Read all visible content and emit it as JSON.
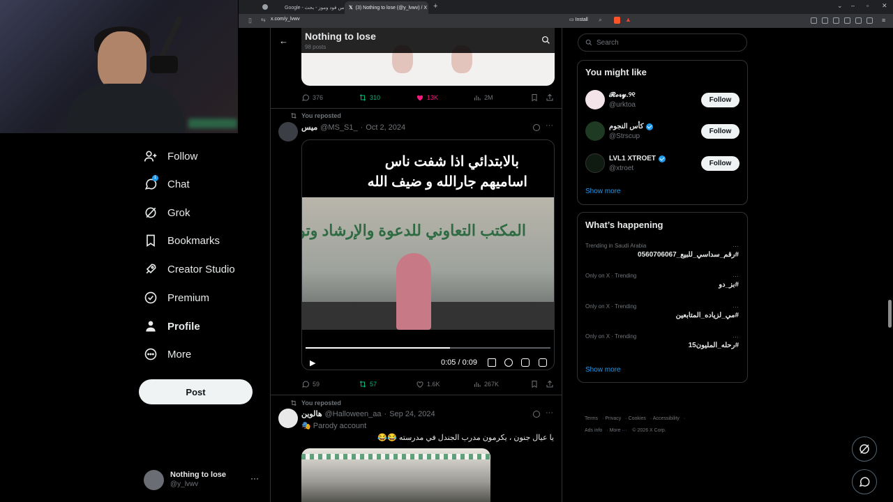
{
  "browser": {
    "tabs": [
      {
        "label": "Google - ريلاكس فود وموز - بحث",
        "active": false
      },
      {
        "label": "(3) Nothing to lose (@y_lvwv) / X",
        "active": true
      }
    ],
    "url": "x.com/y_lvwv",
    "install_label": "Install"
  },
  "nav": {
    "items": [
      {
        "label": "Follow",
        "icon": "person-add-icon"
      },
      {
        "label": "Chat",
        "icon": "chat-icon",
        "badge": "1"
      },
      {
        "label": "Grok",
        "icon": "grok-icon"
      },
      {
        "label": "Bookmarks",
        "icon": "bookmark-icon"
      },
      {
        "label": "Creator Studio",
        "icon": "rocket-icon"
      },
      {
        "label": "Premium",
        "icon": "verified-badge-icon"
      },
      {
        "label": "Profile",
        "icon": "person-icon"
      },
      {
        "label": "More",
        "icon": "more-circle-icon"
      }
    ],
    "post_label": "Post",
    "account": {
      "name": "Nothing to lose",
      "handle": "@y_lvwv"
    }
  },
  "profile_header": {
    "title": "Nothing to lose",
    "subtitle": "98 posts"
  },
  "tweet1": {
    "replies": "376",
    "reposts": "310",
    "likes": "13K",
    "views": "2M"
  },
  "tweet2": {
    "repost_label": "You reposted",
    "name": "ميس",
    "handle": "@MS_S1_",
    "date": "Oct 2, 2024",
    "caption_line1": "بالابتدائي اذا شفت ناس",
    "caption_line2": "اساميهم جارالله و ضيف الله",
    "banner_text": "المكتب التعاوني للدعوة والإرشاد وتوعية الجاليات",
    "video_time": "0:05 / 0:09",
    "video_progress": 0.59,
    "replies": "59",
    "reposts": "57",
    "likes": "1.6K",
    "views": "267K"
  },
  "tweet3": {
    "repost_label": "You reposted",
    "name": "هالوين",
    "handle": "@Halloween_aa",
    "date": "Sep 24, 2024",
    "parody": "Parody account",
    "text": "يا عيال جنون ، يكرمون مدرب الجندل في مدرسته 😂😂"
  },
  "sidebar": {
    "search_placeholder": "Search",
    "you_might_like": {
      "title": "You might like",
      "users": [
        {
          "name": "𝓡𝓸𝓻𝔂.୨୧",
          "handle": "@urktoa",
          "verified": false,
          "avatar_color": "#f3e4ea"
        },
        {
          "name": "كأس النجوم",
          "handle": "@Strscup",
          "verified": true,
          "avatar_color": "#1f3a22"
        },
        {
          "name": "LVL1 XTROET",
          "handle": "@xtroet",
          "verified": true,
          "avatar_color": "#0f1a10"
        }
      ],
      "follow_label": "Follow",
      "show_more": "Show more"
    },
    "whats_happening": {
      "title": "What’s happening",
      "trends": [
        {
          "context": "Trending in Saudi Arabia",
          "tag": "#رقم_سداسي_للبيع_0560706067"
        },
        {
          "context": "Only on X · Trending",
          "tag": "#بز_دو"
        },
        {
          "context": "Only on X · Trending",
          "tag": "#مي_لزياده_المتابعين"
        },
        {
          "context": "Only on X · Trending",
          "tag": "#رحله_المليون15"
        }
      ],
      "show_more": "Show more"
    },
    "footer": {
      "links": [
        "Terms",
        "Privacy",
        "Cookies",
        "Accessibility",
        "Ads info",
        "More ···"
      ],
      "copyright": "© 2026 X Corp."
    }
  },
  "colors": {
    "accent": "#1d9bf0",
    "repost": "#00ba7c",
    "like": "#f91880"
  }
}
